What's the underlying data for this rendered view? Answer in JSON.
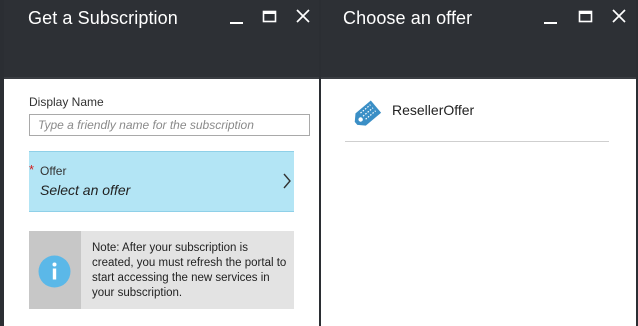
{
  "left_blade": {
    "title": "Get a Subscription",
    "display_name": {
      "label": "Display Name",
      "placeholder": "Type a friendly name for the subscription",
      "value": ""
    },
    "offer": {
      "required_mark": "*",
      "label": "Offer",
      "value": "Select an offer"
    },
    "note": {
      "text": "Note: After your subscription is created, you must refresh the portal to start accessing the new services in your subscription."
    }
  },
  "right_blade": {
    "title": "Choose an offer",
    "offers": [
      {
        "label": "ResellerOffer",
        "icon": "tag-icon"
      }
    ]
  },
  "icons": {
    "minimize": "minimize-icon",
    "maximize": "maximize-icon",
    "close": "close-icon",
    "chevron": "chevron-right-icon",
    "info": "info-icon",
    "tag": "tag-icon"
  },
  "colors": {
    "header_bg": "#2d3035",
    "selected_bg": "#b3e5f5",
    "info_blue": "#5bb8e8",
    "tag_blue": "#3b8fc6",
    "required": "#d21b1b"
  }
}
